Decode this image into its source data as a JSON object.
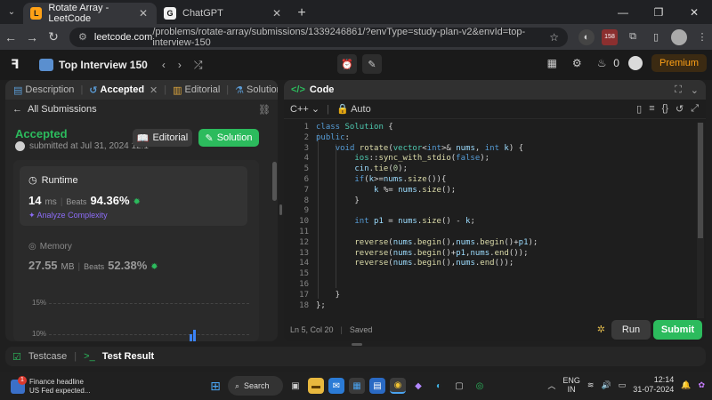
{
  "browser": {
    "tabs": [
      {
        "title": "Rotate Array - LeetCode",
        "icon_text": "L"
      },
      {
        "title": "ChatGPT",
        "icon_text": "G"
      }
    ],
    "url_host": "leetcode.com",
    "url_path": "/problems/rotate-array/submissions/1339246861/?envType=study-plan-v2&envId=top-interview-150",
    "extension_badge": "158"
  },
  "header": {
    "title": "Top Interview 150",
    "streak_count": "0",
    "premium_label": "Premium"
  },
  "left": {
    "tabs": [
      {
        "label": "Description"
      },
      {
        "label": "Accepted"
      },
      {
        "label": "Editorial"
      },
      {
        "label": "Solutions"
      },
      {
        "label": "Su"
      }
    ],
    "all_submissions": "All Submissions",
    "status": "Accepted",
    "submitted_at": "submitted at Jul 31, 2024 12:1",
    "editorial_btn": "Editorial",
    "solution_btn": "Solution",
    "runtime": {
      "heading": "Runtime",
      "value": "14",
      "unit": "ms",
      "beats_label": "Beats",
      "beats_pct": "94.36%",
      "analyze": "Analyze Complexity"
    },
    "memory": {
      "heading": "Memory",
      "value": "27.55",
      "unit": "MB",
      "beats_label": "Beats",
      "beats_pct": "52.38%"
    },
    "chart_axis": [
      "15%",
      "10%"
    ]
  },
  "right": {
    "title": "Code",
    "language": "C++",
    "mode": "Auto",
    "line_numbers": [
      "1",
      "2",
      "3",
      "4",
      "5",
      "6",
      "7",
      "8",
      "9",
      "10",
      "11",
      "12",
      "13",
      "14",
      "15",
      "16",
      "17",
      "18"
    ],
    "status_pos": "Ln 5, Col 20",
    "status_saved": "Saved",
    "run_btn": "Run",
    "submit_btn": "Submit"
  },
  "bottom": {
    "testcase": "Testcase",
    "result": "Test Result"
  },
  "taskbar": {
    "news_title": "Finance headline",
    "news_sub": "US Fed expected...",
    "news_badge": "1",
    "search": "Search",
    "lang1": "ENG",
    "lang2": "IN",
    "time": "12:14",
    "date": "31-07-2024"
  }
}
